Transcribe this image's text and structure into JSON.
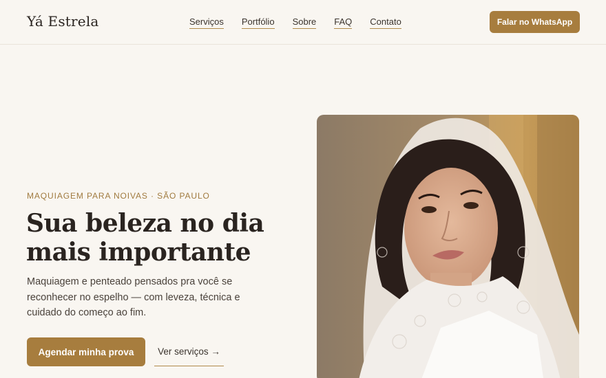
{
  "header": {
    "logo": "Yá Estrela",
    "nav": [
      "Serviços",
      "Portfólio",
      "Sobre",
      "FAQ",
      "Contato"
    ],
    "cta": "Falar no WhatsApp"
  },
  "hero": {
    "eyebrow": "MAQUIAGEM PARA NOIVAS · SÃO PAULO",
    "headline_line1": "Sua beleza no dia",
    "headline_line2": "mais importante",
    "description": "Maquiagem e penteado pensados pra você se reconhecer no espelho — com leveza, técnica e cuidado do começo ao fim.",
    "primary_cta": "Agendar minha prova",
    "secondary_cta": "Ver serviços →"
  },
  "colors": {
    "background": "#f9f6f1",
    "accent": "#a77d3e",
    "text": "#2a2420"
  }
}
